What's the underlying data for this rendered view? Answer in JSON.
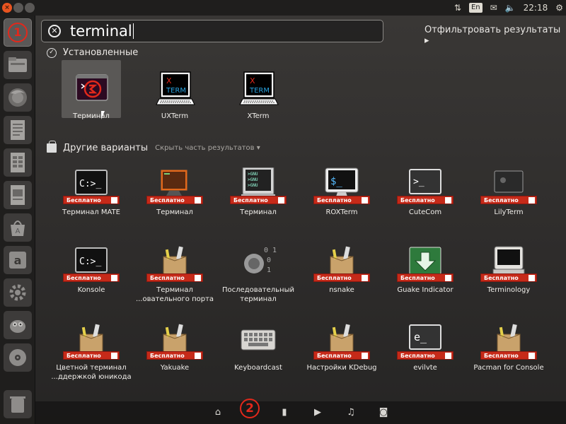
{
  "top_panel": {
    "close_glyph": "×",
    "lang": "En",
    "time": "22:18"
  },
  "search": {
    "query": "terminal",
    "filter_label": "Отфильтровать результаты ▸"
  },
  "installed": {
    "header": "Установленные",
    "items": [
      {
        "label": "Терминал"
      },
      {
        "label": "UXTerm"
      },
      {
        "label": "XTerm"
      }
    ]
  },
  "other": {
    "header": "Другие варианты",
    "hide_link": "Скрыть часть результатов ▾",
    "badge_text": "Бесплатно",
    "items": [
      {
        "label": "Терминал MATE"
      },
      {
        "label": "Терминал"
      },
      {
        "label": "Терминал"
      },
      {
        "label": "ROXTerm"
      },
      {
        "label": "CuteCom"
      },
      {
        "label": "LilyTerm"
      },
      {
        "label": "Konsole"
      },
      {
        "label": "Терминал ...овательного порта"
      },
      {
        "label": "Последовательный терминал"
      },
      {
        "label": "nsnake"
      },
      {
        "label": "Guake Indicator"
      },
      {
        "label": "Terminology"
      },
      {
        "label": "Цветной терминал ...ддержкой юникода"
      },
      {
        "label": "Yakuake"
      },
      {
        "label": "Keyboardcast"
      },
      {
        "label": "Настройки KDebug"
      },
      {
        "label": "evilvte"
      },
      {
        "label": "Pacman for Console"
      }
    ]
  },
  "annotations": {
    "one": "1",
    "two": "2"
  },
  "icons": {
    "xterm_x": "X",
    "xterm_term": "TERM",
    "cmd_prompt": "C:>_",
    "evil_prompt": "e_",
    "cute_prompt": ">_",
    "rox_prompt": "$_"
  }
}
